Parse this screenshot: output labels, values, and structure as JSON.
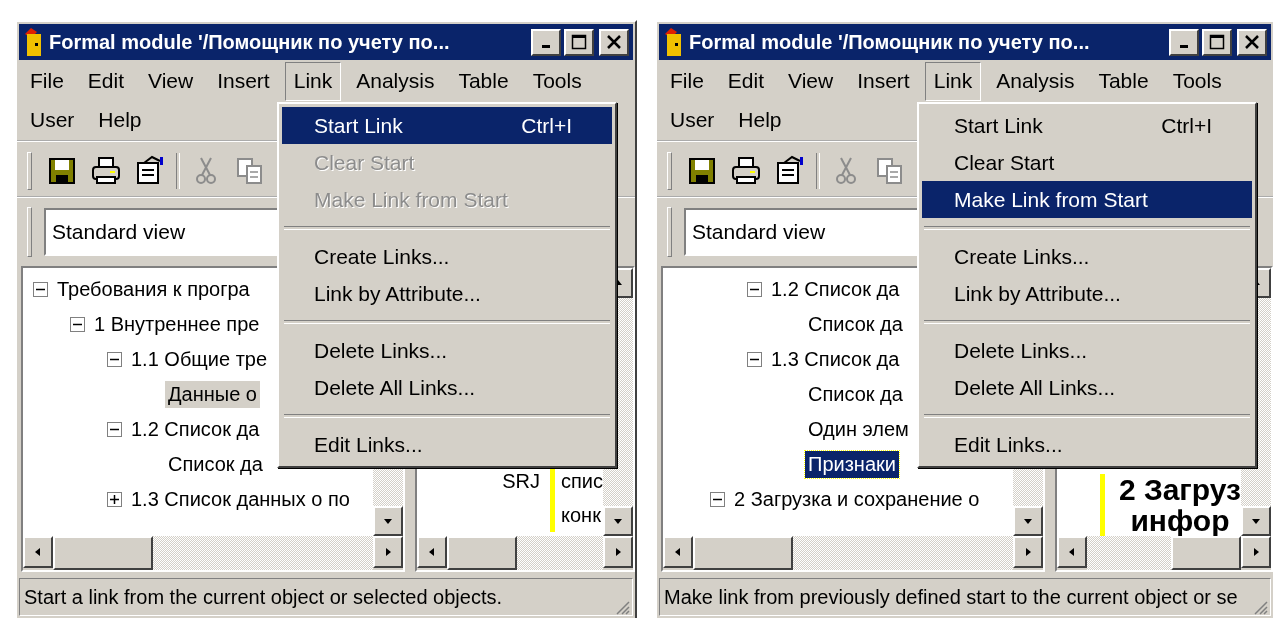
{
  "windows": [
    {
      "title": "Formal module '/Помощник по учету по...",
      "menubar": [
        {
          "label": "File",
          "selected": false
        },
        {
          "label": "Edit",
          "selected": false
        },
        {
          "label": "View",
          "selected": false
        },
        {
          "label": "Insert",
          "selected": false
        },
        {
          "label": "Link",
          "selected": true
        },
        {
          "label": "Analysis",
          "selected": false
        },
        {
          "label": "Table",
          "selected": false
        },
        {
          "label": "Tools",
          "selected": false
        },
        {
          "label": "User",
          "selected": false
        },
        {
          "label": "Help",
          "selected": false
        }
      ],
      "toolbar": [
        {
          "kind": "save",
          "disabled": false
        },
        {
          "kind": "print",
          "disabled": false
        },
        {
          "kind": "properties",
          "disabled": false
        },
        {
          "kind": "separator"
        },
        {
          "kind": "cut",
          "disabled": true
        },
        {
          "kind": "copy",
          "disabled": true
        }
      ],
      "view": {
        "value": "Standard view"
      },
      "tree": {
        "focused": false,
        "items": [
          {
            "label": "Требования к програ",
            "kind": "branch",
            "expanded": true,
            "selected": false,
            "children": [
              {
                "label": "1 Внутреннее пре",
                "kind": "branch",
                "expanded": true,
                "selected": false,
                "children": [
                  {
                    "label": "1.1 Общие тре",
                    "kind": "branch",
                    "expanded": true,
                    "selected": false,
                    "children": [
                      {
                        "label": "Данные о",
                        "kind": "leaf",
                        "selected": true
                      }
                    ]
                  },
                  {
                    "label": "1.2 Список да",
                    "kind": "branch",
                    "expanded": true,
                    "selected": false,
                    "children": [
                      {
                        "label": "Список да",
                        "kind": "leaf",
                        "selected": false
                      }
                    ]
                  },
                  {
                    "label": "1.3 Список данных о по",
                    "kind": "branch",
                    "expanded": false,
                    "selected": false
                  }
                ]
              }
            ]
          }
        ]
      },
      "details": {
        "kind": "plain",
        "column_1": [
          "SRJ"
        ],
        "column_2": [
          "спис",
          "конк"
        ]
      },
      "menu": {
        "items": [
          {
            "kind": "item",
            "label": "Start Link",
            "shortcut": "Ctrl+I",
            "selected": true,
            "disabled": false
          },
          {
            "kind": "item",
            "label": "Clear Start",
            "selected": false,
            "disabled": true
          },
          {
            "kind": "item",
            "label": "Make Link from Start",
            "selected": false,
            "disabled": true
          },
          {
            "kind": "separator"
          },
          {
            "kind": "item",
            "label": "Create Links...",
            "selected": false,
            "disabled": false
          },
          {
            "kind": "item",
            "label": "Link by Attribute...",
            "selected": false,
            "disabled": false
          },
          {
            "kind": "separator"
          },
          {
            "kind": "item",
            "label": "Delete Links...",
            "selected": false,
            "disabled": false
          },
          {
            "kind": "item",
            "label": "Delete All Links...",
            "selected": false,
            "disabled": false
          },
          {
            "kind": "separator"
          },
          {
            "kind": "item",
            "label": "Edit Links...",
            "selected": false,
            "disabled": false
          }
        ]
      },
      "status_bar": "Start a link from the current object or selected objects."
    },
    {
      "title": "Formal module '/Помощник по учету по...",
      "menubar": [
        {
          "label": "File",
          "selected": false
        },
        {
          "label": "Edit",
          "selected": false
        },
        {
          "label": "View",
          "selected": false
        },
        {
          "label": "Insert",
          "selected": false
        },
        {
          "label": "Link",
          "selected": true
        },
        {
          "label": "Analysis",
          "selected": false
        },
        {
          "label": "Table",
          "selected": false
        },
        {
          "label": "Tools",
          "selected": false
        },
        {
          "label": "User",
          "selected": false
        },
        {
          "label": "Help",
          "selected": false
        }
      ],
      "toolbar": [
        {
          "kind": "save",
          "disabled": false
        },
        {
          "kind": "print",
          "disabled": false
        },
        {
          "kind": "properties",
          "disabled": false
        },
        {
          "kind": "separator"
        },
        {
          "kind": "cut",
          "disabled": true
        },
        {
          "kind": "copy",
          "disabled": true
        }
      ],
      "view": {
        "value": "Standard view"
      },
      "tree": {
        "focused": true,
        "items": [
          {
            "kind": "offscreen",
            "children": [
              {
                "kind": "offscreen",
                "children": [
                  {
                    "label": "1.2 Список да",
                    "kind": "branch",
                    "expanded": true,
                    "selected": false,
                    "children": [
                      {
                        "label": "Список да",
                        "kind": "leaf",
                        "selected": false
                      }
                    ]
                  },
                  {
                    "label": "1.3 Список да",
                    "kind": "branch",
                    "expanded": true,
                    "selected": false,
                    "children": [
                      {
                        "label": "Список да",
                        "kind": "leaf",
                        "selected": false
                      },
                      {
                        "label": "Один элем",
                        "kind": "leaf",
                        "selected": false
                      },
                      {
                        "label": "Признаки",
                        "kind": "leaf",
                        "selected": true
                      }
                    ]
                  }
                ]
              },
              {
                "label": "2 Загрузка и сохранение о",
                "kind": "branch",
                "expanded": true,
                "selected": false
              }
            ]
          }
        ]
      },
      "details": {
        "kind": "heading",
        "column_2": [
          "2 Загруз",
          "инфор"
        ]
      },
      "menu": {
        "items": [
          {
            "kind": "item",
            "label": "Start Link",
            "shortcut": "Ctrl+I",
            "selected": false,
            "disabled": false
          },
          {
            "kind": "item",
            "label": "Clear Start",
            "selected": false,
            "disabled": false
          },
          {
            "kind": "item",
            "label": "Make Link from Start",
            "selected": true,
            "disabled": false
          },
          {
            "kind": "separator"
          },
          {
            "kind": "item",
            "label": "Create Links...",
            "selected": false,
            "disabled": false
          },
          {
            "kind": "item",
            "label": "Link by Attribute...",
            "selected": false,
            "disabled": false
          },
          {
            "kind": "separator"
          },
          {
            "kind": "item",
            "label": "Delete Links...",
            "selected": false,
            "disabled": false
          },
          {
            "kind": "item",
            "label": "Delete All Links...",
            "selected": false,
            "disabled": false
          },
          {
            "kind": "separator"
          },
          {
            "kind": "item",
            "label": "Edit Links...",
            "selected": false,
            "disabled": false
          }
        ]
      },
      "status_bar": "Make link from previously defined start to the current object or se"
    }
  ]
}
